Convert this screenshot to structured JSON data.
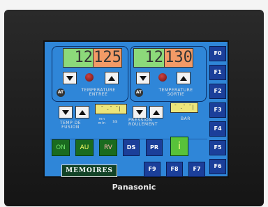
{
  "device": {
    "brand": "Panasonic"
  },
  "temp_entree": {
    "setpoint": "12",
    "actual": "125",
    "label": "TEMPERATURE\nENTREE",
    "at": "AT"
  },
  "temp_sortie": {
    "setpoint": "12",
    "actual": "130",
    "label": "TEMPERATURE\nSORTIE",
    "at": "AT"
  },
  "fusion": {
    "label": "TEMP DE\nFUSION",
    "unit": "mn\nmin",
    "unit2": "ss",
    "display": "¯ .¯ ¯|"
  },
  "pression": {
    "label": "PRESSION\nROULEMENT",
    "unit": "BAR",
    "display": "¯ .¯ ¯|"
  },
  "modes": [
    "ON",
    "AU",
    "RV",
    "DS",
    "PR",
    "i"
  ],
  "memoires": "MEMOIRES",
  "fkeys_right": [
    "F0",
    "F1",
    "F2",
    "F3",
    "F4",
    "F5",
    "F6"
  ],
  "fkeys_bottom": [
    "F9",
    "F8",
    "F7"
  ],
  "colors": {
    "screen": "#2f86d8",
    "key": "#1b3f9a",
    "mode_bg": "#1a6b1f"
  }
}
